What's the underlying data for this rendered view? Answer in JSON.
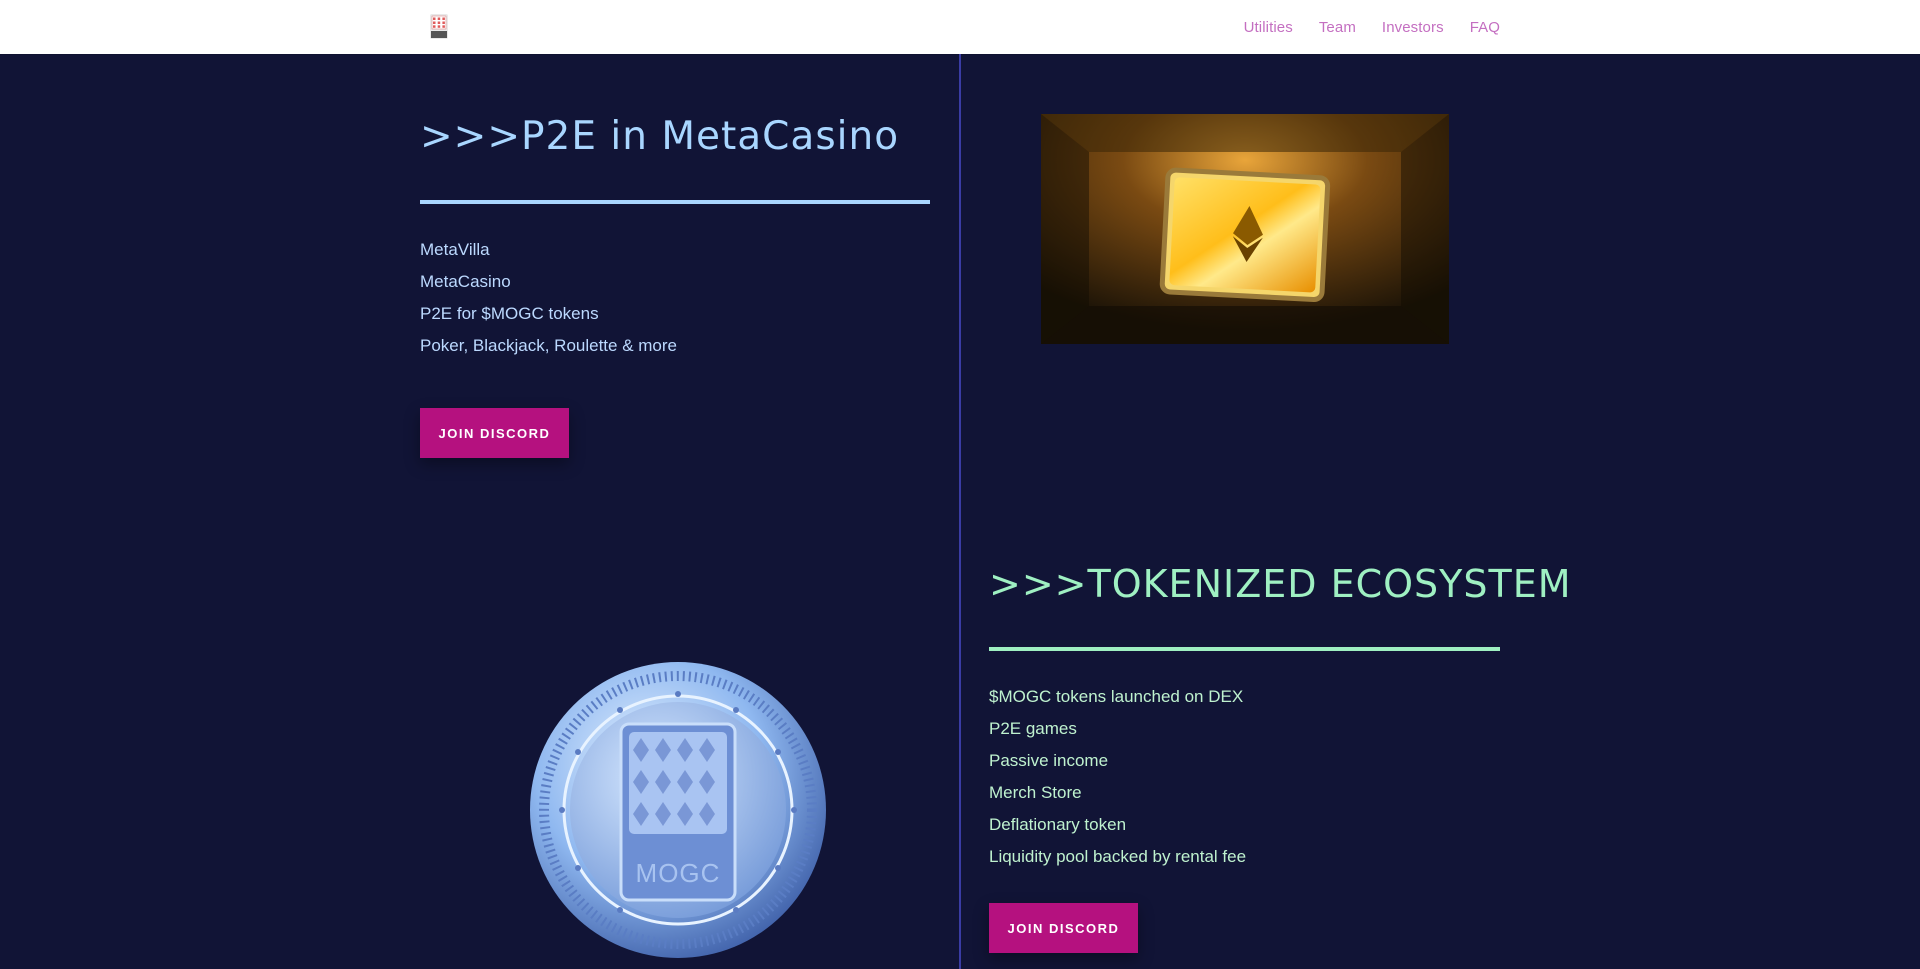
{
  "header": {
    "logo_icon": "slot-machine-logo-icon",
    "nav": [
      "Utilities",
      "Team",
      "Investors",
      "FAQ"
    ]
  },
  "section_casino": {
    "title": ">>>P2E in MetaCasino",
    "items": [
      "MetaVilla",
      "MetaCasino",
      "P2E for $MOGC tokens",
      "Poker, Blackjack, Roulette & more"
    ],
    "button_label": "JOIN DISCORD"
  },
  "section_ecosystem": {
    "title": ">>>TOKENIZED ECOSYSTEM",
    "items": [
      "$MOGC tokens launched on DEX",
      "P2E games",
      "Passive income",
      "Merch Store",
      "Deflationary token",
      "Liquidity pool backed by rental fee"
    ],
    "button_label": "JOIN DISCORD"
  },
  "coin": {
    "label": "MOGC"
  },
  "colors": {
    "background": "#111436",
    "nav": "#c46fc1",
    "casino_accent": "#a9d6ff",
    "ecosystem_accent": "#9ff0c2",
    "button": "#b5117f",
    "divider": "#3a3ca4"
  }
}
